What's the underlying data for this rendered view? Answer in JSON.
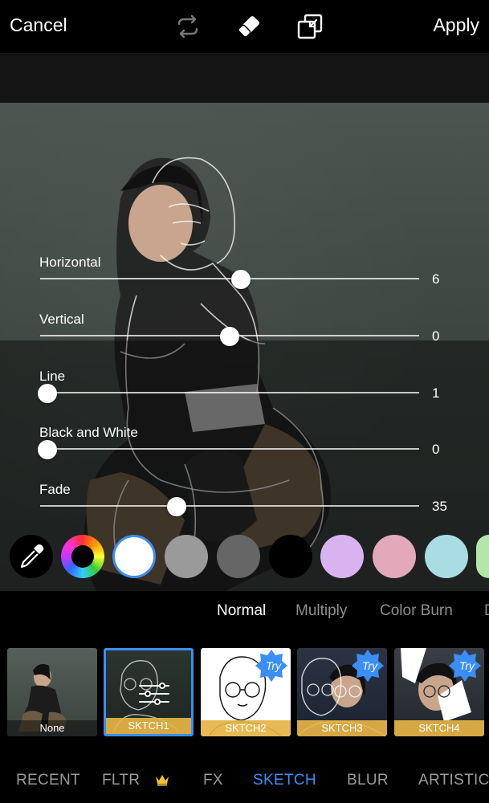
{
  "topbar": {
    "cancel_label": "Cancel",
    "apply_label": "Apply",
    "icons": [
      "swap-icon",
      "eraser-icon",
      "compare-icon"
    ]
  },
  "sliders": [
    {
      "label": "Horizontal",
      "value": "6",
      "position": 0.53
    },
    {
      "label": "Vertical",
      "value": "0",
      "position": 0.5
    },
    {
      "label": "Line",
      "value": "1",
      "position": 0.02
    },
    {
      "label": "Black and White",
      "value": "0",
      "position": 0.02
    },
    {
      "label": "Fade",
      "value": "35",
      "position": 0.36
    }
  ],
  "colors": {
    "selected": "#ffffff",
    "swatches": [
      "#ffffff",
      "#9a9a9a",
      "#666666",
      "#000000",
      "#d9b3ef",
      "#e3a9bb",
      "#a9dde3",
      "#b5e6a9"
    ]
  },
  "blend_modes": {
    "items": [
      "Normal",
      "Multiply",
      "Color Burn",
      "D"
    ],
    "active": "Normal"
  },
  "effects": [
    {
      "label": "None",
      "try": ""
    },
    {
      "label": "SKTCH1",
      "try": ""
    },
    {
      "label": "SKTCH2",
      "try": "Try"
    },
    {
      "label": "SKTCH3",
      "try": "Try"
    },
    {
      "label": "SKTCH4",
      "try": "Try"
    }
  ],
  "categories": {
    "items": [
      "RECENT",
      "FLTR",
      "FX",
      "SKETCH",
      "BLUR",
      "ARTISTIC"
    ],
    "active": "SKETCH"
  },
  "accent_color": "#3a8ef6",
  "premium_color": "#f0c23a"
}
